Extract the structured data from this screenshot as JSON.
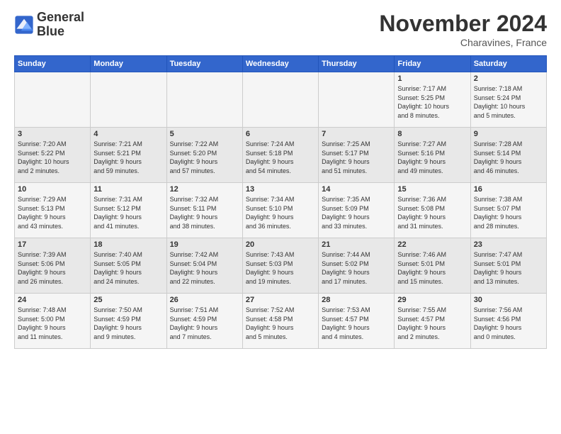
{
  "header": {
    "logo_line1": "General",
    "logo_line2": "Blue",
    "month": "November 2024",
    "location": "Charavines, France"
  },
  "days_of_week": [
    "Sunday",
    "Monday",
    "Tuesday",
    "Wednesday",
    "Thursday",
    "Friday",
    "Saturday"
  ],
  "weeks": [
    [
      {
        "day": "",
        "info": ""
      },
      {
        "day": "",
        "info": ""
      },
      {
        "day": "",
        "info": ""
      },
      {
        "day": "",
        "info": ""
      },
      {
        "day": "",
        "info": ""
      },
      {
        "day": "1",
        "info": "Sunrise: 7:17 AM\nSunset: 5:25 PM\nDaylight: 10 hours\nand 8 minutes."
      },
      {
        "day": "2",
        "info": "Sunrise: 7:18 AM\nSunset: 5:24 PM\nDaylight: 10 hours\nand 5 minutes."
      }
    ],
    [
      {
        "day": "3",
        "info": "Sunrise: 7:20 AM\nSunset: 5:22 PM\nDaylight: 10 hours\nand 2 minutes."
      },
      {
        "day": "4",
        "info": "Sunrise: 7:21 AM\nSunset: 5:21 PM\nDaylight: 9 hours\nand 59 minutes."
      },
      {
        "day": "5",
        "info": "Sunrise: 7:22 AM\nSunset: 5:20 PM\nDaylight: 9 hours\nand 57 minutes."
      },
      {
        "day": "6",
        "info": "Sunrise: 7:24 AM\nSunset: 5:18 PM\nDaylight: 9 hours\nand 54 minutes."
      },
      {
        "day": "7",
        "info": "Sunrise: 7:25 AM\nSunset: 5:17 PM\nDaylight: 9 hours\nand 51 minutes."
      },
      {
        "day": "8",
        "info": "Sunrise: 7:27 AM\nSunset: 5:16 PM\nDaylight: 9 hours\nand 49 minutes."
      },
      {
        "day": "9",
        "info": "Sunrise: 7:28 AM\nSunset: 5:14 PM\nDaylight: 9 hours\nand 46 minutes."
      }
    ],
    [
      {
        "day": "10",
        "info": "Sunrise: 7:29 AM\nSunset: 5:13 PM\nDaylight: 9 hours\nand 43 minutes."
      },
      {
        "day": "11",
        "info": "Sunrise: 7:31 AM\nSunset: 5:12 PM\nDaylight: 9 hours\nand 41 minutes."
      },
      {
        "day": "12",
        "info": "Sunrise: 7:32 AM\nSunset: 5:11 PM\nDaylight: 9 hours\nand 38 minutes."
      },
      {
        "day": "13",
        "info": "Sunrise: 7:34 AM\nSunset: 5:10 PM\nDaylight: 9 hours\nand 36 minutes."
      },
      {
        "day": "14",
        "info": "Sunrise: 7:35 AM\nSunset: 5:09 PM\nDaylight: 9 hours\nand 33 minutes."
      },
      {
        "day": "15",
        "info": "Sunrise: 7:36 AM\nSunset: 5:08 PM\nDaylight: 9 hours\nand 31 minutes."
      },
      {
        "day": "16",
        "info": "Sunrise: 7:38 AM\nSunset: 5:07 PM\nDaylight: 9 hours\nand 28 minutes."
      }
    ],
    [
      {
        "day": "17",
        "info": "Sunrise: 7:39 AM\nSunset: 5:06 PM\nDaylight: 9 hours\nand 26 minutes."
      },
      {
        "day": "18",
        "info": "Sunrise: 7:40 AM\nSunset: 5:05 PM\nDaylight: 9 hours\nand 24 minutes."
      },
      {
        "day": "19",
        "info": "Sunrise: 7:42 AM\nSunset: 5:04 PM\nDaylight: 9 hours\nand 22 minutes."
      },
      {
        "day": "20",
        "info": "Sunrise: 7:43 AM\nSunset: 5:03 PM\nDaylight: 9 hours\nand 19 minutes."
      },
      {
        "day": "21",
        "info": "Sunrise: 7:44 AM\nSunset: 5:02 PM\nDaylight: 9 hours\nand 17 minutes."
      },
      {
        "day": "22",
        "info": "Sunrise: 7:46 AM\nSunset: 5:01 PM\nDaylight: 9 hours\nand 15 minutes."
      },
      {
        "day": "23",
        "info": "Sunrise: 7:47 AM\nSunset: 5:01 PM\nDaylight: 9 hours\nand 13 minutes."
      }
    ],
    [
      {
        "day": "24",
        "info": "Sunrise: 7:48 AM\nSunset: 5:00 PM\nDaylight: 9 hours\nand 11 minutes."
      },
      {
        "day": "25",
        "info": "Sunrise: 7:50 AM\nSunset: 4:59 PM\nDaylight: 9 hours\nand 9 minutes."
      },
      {
        "day": "26",
        "info": "Sunrise: 7:51 AM\nSunset: 4:59 PM\nDaylight: 9 hours\nand 7 minutes."
      },
      {
        "day": "27",
        "info": "Sunrise: 7:52 AM\nSunset: 4:58 PM\nDaylight: 9 hours\nand 5 minutes."
      },
      {
        "day": "28",
        "info": "Sunrise: 7:53 AM\nSunset: 4:57 PM\nDaylight: 9 hours\nand 4 minutes."
      },
      {
        "day": "29",
        "info": "Sunrise: 7:55 AM\nSunset: 4:57 PM\nDaylight: 9 hours\nand 2 minutes."
      },
      {
        "day": "30",
        "info": "Sunrise: 7:56 AM\nSunset: 4:56 PM\nDaylight: 9 hours\nand 0 minutes."
      }
    ]
  ]
}
